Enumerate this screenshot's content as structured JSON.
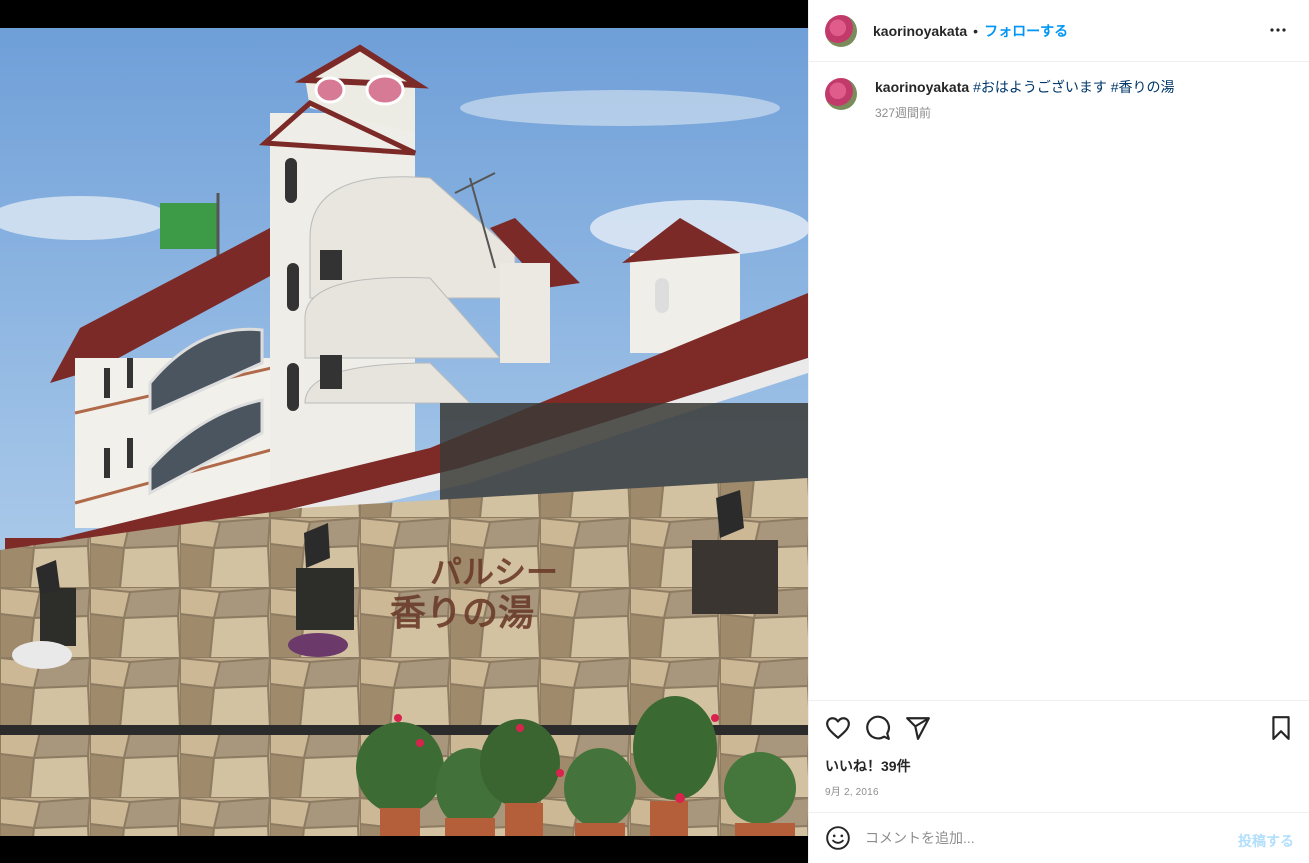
{
  "post": {
    "username": "kaorinoyakata",
    "separator": "•",
    "follow_label": "フォローする",
    "more_icon": "more-horizontal-icon",
    "caption": {
      "username": "kaorinoyakata",
      "hashtags": [
        "#おはようございます",
        "#香りの湯"
      ],
      "time_ago": "327週間前"
    },
    "likes_label": "いいね！39件",
    "date": "9月 2, 2016",
    "comment_placeholder": "コメントを追加...",
    "post_button": "投稿する",
    "photo_sign": {
      "line1": "パルシー",
      "line2": "香りの湯"
    }
  },
  "colors": {
    "link_blue": "#0095f6",
    "hashtag": "#00376b",
    "post_disabled": "#b2dffc"
  }
}
